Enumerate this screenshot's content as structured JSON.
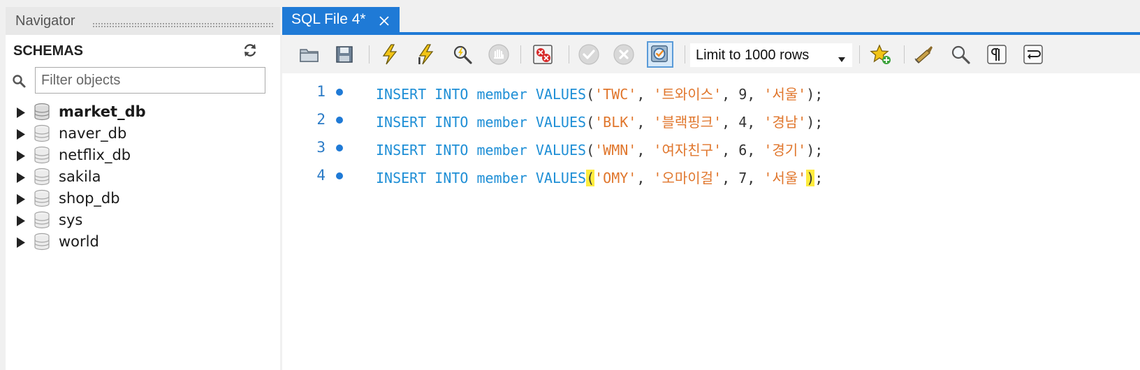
{
  "navigator": {
    "title": "Navigator",
    "section_label": "SCHEMAS",
    "filter_placeholder": "Filter objects",
    "schemas": [
      {
        "name": "market_db",
        "active": true
      },
      {
        "name": "naver_db",
        "active": false
      },
      {
        "name": "netflix_db",
        "active": false
      },
      {
        "name": "sakila",
        "active": false
      },
      {
        "name": "shop_db",
        "active": false
      },
      {
        "name": "sys",
        "active": false
      },
      {
        "name": "world",
        "active": false
      }
    ]
  },
  "editor": {
    "tab_title": "SQL File 4*",
    "limit_label": "Limit to 1000 rows",
    "lines": [
      {
        "num": "1",
        "kw1": "INSERT",
        "kw2": "INTO",
        "table": "member",
        "kw3": "VALUES",
        "s1": "'TWC'",
        "s2": "'트와이스'",
        "n": "9",
        "s3": "'서울'"
      },
      {
        "num": "2",
        "kw1": "INSERT",
        "kw2": "INTO",
        "table": "member",
        "kw3": "VALUES",
        "s1": "'BLK'",
        "s2": "'블랙핑크'",
        "n": "4",
        "s3": "'경남'"
      },
      {
        "num": "3",
        "kw1": "INSERT",
        "kw2": "INTO",
        "table": "member",
        "kw3": "VALUES",
        "s1": "'WMN'",
        "s2": "'여자친구'",
        "n": "6",
        "s3": "'경기'"
      },
      {
        "num": "4",
        "kw1": "INSERT",
        "kw2": "INTO",
        "table": "member",
        "kw3": "VALUES",
        "s1": "'OMY'",
        "s2": "'오마이걸'",
        "n": "7",
        "s3": "'서울'"
      }
    ]
  },
  "colors": {
    "accent": "#1f7ad6",
    "keyword": "#1f8fd6",
    "string": "#e0762c",
    "brace_highlight": "#ffec3d"
  },
  "icons": {
    "toolbar": [
      "open-folder-icon",
      "save-icon",
      "execute-icon",
      "execute-current-icon",
      "explain-icon",
      "stop-icon",
      "toggle-error-continue-icon",
      "commit-icon",
      "rollback-icon",
      "autocommit-icon",
      "dropdown-caret-icon",
      "favorite-snippet-icon",
      "beautify-icon",
      "find-icon",
      "invisible-chars-icon",
      "word-wrap-icon"
    ],
    "navigator": [
      "refresh-icon",
      "search-icon",
      "expand-arrow-icon",
      "database-icon"
    ],
    "tab": [
      "close-icon"
    ]
  }
}
